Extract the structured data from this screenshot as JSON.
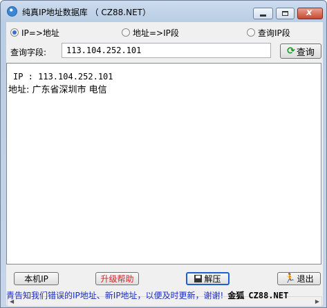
{
  "window": {
    "title": "纯真IP地址数据库 （ CZ88.NET）",
    "controls": {
      "minimize": "minimize",
      "maximize": "maximize",
      "close": "x"
    }
  },
  "search_mode": {
    "options": [
      {
        "label": "IP=>地址",
        "selected": true
      },
      {
        "label": "地址=>IP段",
        "selected": false
      },
      {
        "label": "查询IP段",
        "selected": false
      }
    ]
  },
  "query": {
    "label": "查询字段:",
    "value": "113.104.252.101",
    "button_label": "查询"
  },
  "result": {
    "ip_line": "IP : 113.104.252.101",
    "address_line": "地址: 广东省深圳市 电信"
  },
  "buttons": {
    "local_ip": "本机IP",
    "upgrade_help": "升级帮助",
    "unzip": "解压",
    "exit": "退出"
  },
  "status_bar": {
    "message": "青告知我们错误的IP地址、新IP地址，以便及时更新，谢谢!",
    "brand": "金狐",
    "url": "CZ88.NET"
  },
  "colors": {
    "upgrade_text": "#e02020",
    "status_text": "#1b2fbf",
    "refresh_icon": "#1a9a2a"
  }
}
